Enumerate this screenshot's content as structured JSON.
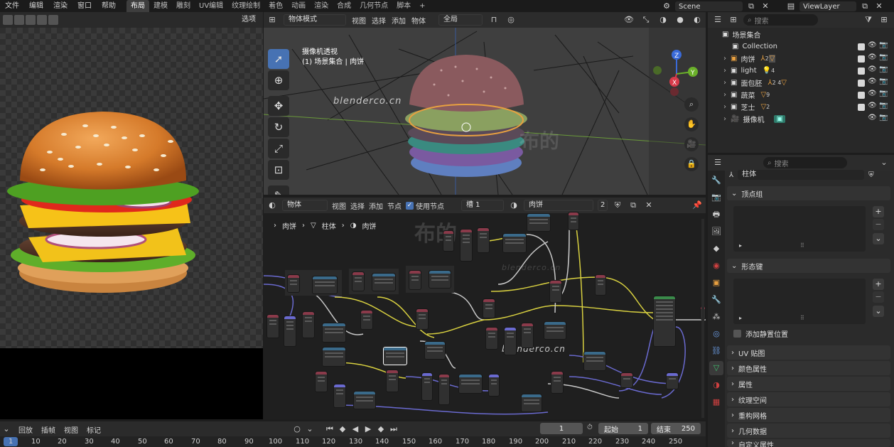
{
  "topbar": {
    "menus": [
      "文件",
      "编辑",
      "渲染",
      "窗口",
      "帮助"
    ],
    "tabs": [
      "布局",
      "建模",
      "雕刻",
      "UV编辑",
      "纹理绘制",
      "着色",
      "动画",
      "渲染",
      "合成",
      "几何节点",
      "脚本"
    ],
    "active_tab": "布局",
    "add_tab": "+",
    "scene": "Scene",
    "viewlayer": "ViewLayer"
  },
  "image_editor": {
    "select_label": "选项"
  },
  "viewport": {
    "mode": "物体模式",
    "menus": [
      "视图",
      "选择",
      "添加",
      "物体"
    ],
    "transform": "全局",
    "options_label": "选项",
    "overlay_line1": "摄像机透视",
    "overlay_line2": "(1) 场景集合 | 肉饼",
    "watermark": "blenderco.cn",
    "watermark2": "布的",
    "gizmo": {
      "x": "X",
      "y": "Y",
      "z": "Z"
    }
  },
  "node_editor": {
    "type": "物体",
    "menus": [
      "视图",
      "选择",
      "添加",
      "节点"
    ],
    "use_nodes": "使用节点",
    "slot": "槽 1",
    "material": "肉饼",
    "users": "2",
    "breadcrumb": [
      "肉饼",
      "柱体",
      "肉饼"
    ],
    "watermark": "blenderco.cn",
    "watermark_cn": "布的"
  },
  "outliner": {
    "search_placeholder": "搜索",
    "root": "场景集合",
    "collection": "Collection",
    "items": [
      {
        "name": "肉饼",
        "badge": "2"
      },
      {
        "name": "light",
        "badge": "4"
      },
      {
        "name": "面包胚",
        "badge": "2  4"
      },
      {
        "name": "蔬菜",
        "badge": "9"
      },
      {
        "name": "芝士",
        "badge": "2"
      },
      {
        "name": "摄像机",
        "badge": ""
      }
    ]
  },
  "properties": {
    "search_placeholder": "搜索",
    "object_name": "柱体",
    "sections": {
      "vertex_groups": "顶点组",
      "shape_keys": "形态键",
      "rest_position": "添加静置位置",
      "uv_maps": "UV 贴图",
      "color_attr": "颜色属性",
      "attributes": "属性",
      "texture_space": "纹理空间",
      "remesh": "重构网格",
      "geometry_data": "几何数据",
      "custom_props": "自定义属性"
    }
  },
  "timeline": {
    "menus": [
      "回放",
      "插帧",
      "视图",
      "标记"
    ],
    "current_frame": "1",
    "start_label": "起始",
    "start": "1",
    "end_label": "结束",
    "end": "250",
    "ticks": [
      "1",
      "10",
      "20",
      "30",
      "40",
      "50",
      "60",
      "70",
      "80",
      "90",
      "100",
      "110",
      "120",
      "130",
      "140",
      "150",
      "160",
      "170",
      "180",
      "190",
      "200",
      "210",
      "220",
      "230",
      "240",
      "250"
    ]
  }
}
